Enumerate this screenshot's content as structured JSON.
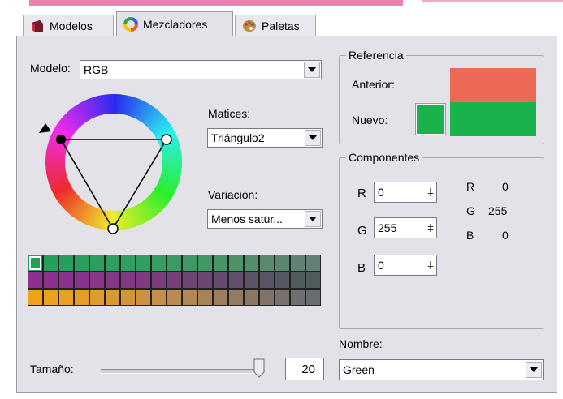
{
  "tabs": [
    {
      "label": "Modelos",
      "icon": "cube-icon",
      "active": false
    },
    {
      "label": "Mezcladores",
      "icon": "color-ring-icon",
      "active": true
    },
    {
      "label": "Paletas",
      "icon": "palette-icon",
      "active": false
    }
  ],
  "model": {
    "label": "Modelo:",
    "value": "RGB"
  },
  "hues": {
    "label": "Matices:",
    "value": "Triángulo2"
  },
  "variation": {
    "label": "Variación:",
    "value": "Menos satur..."
  },
  "reference": {
    "title": "Referencia",
    "previous_label": "Anterior:",
    "new_label": "Nuevo:",
    "previous_color": "#ec6a55",
    "new_color": "#19b24c"
  },
  "components": {
    "title": "Componentes",
    "fields": [
      {
        "label": "R",
        "value": "0"
      },
      {
        "label": "G",
        "value": "255"
      },
      {
        "label": "B",
        "value": "0"
      }
    ],
    "readout": [
      {
        "label": "R",
        "value": "0"
      },
      {
        "label": "G",
        "value": "255"
      },
      {
        "label": "B",
        "value": "0"
      }
    ]
  },
  "name": {
    "label": "Nombre:",
    "value": "Green"
  },
  "size": {
    "label": "Tamaño:",
    "value": "20"
  },
  "swatch_rows": [
    {
      "colors": [
        "#21a05a",
        "#23a05b",
        "#25a05c",
        "#27a05e",
        "#2aa05f",
        "#2d9f60",
        "#309f61",
        "#339e62",
        "#369d63",
        "#3a9c64",
        "#3e9a65",
        "#429866",
        "#479667",
        "#4c9468",
        "#518f6a",
        "#578b6c",
        "#5c876f",
        "#618372",
        "#647f74"
      ]
    },
    {
      "colors": [
        "#8e2f92",
        "#8d3090",
        "#8c318e",
        "#8a338c",
        "#88358a",
        "#853787",
        "#823984",
        "#7e3b81",
        "#7a3e7d",
        "#76417a",
        "#714476",
        "#6c4772",
        "#674b6f",
        "#624f6b",
        "#5d5268",
        "#595565",
        "#555862",
        "#525b5f",
        "#4f5c5d"
      ]
    },
    {
      "colors": [
        "#f0a11c",
        "#eda020",
        "#e99e25",
        "#e59c2a",
        "#e09a30",
        "#da9835",
        "#d3953b",
        "#cc9241",
        "#c48f47",
        "#bb8b4d",
        "#b28753",
        "#a88358",
        "#9e7f5d",
        "#947b62",
        "#8a7766",
        "#80736a",
        "#77706d",
        "#6f6e70",
        "#6a6d70"
      ]
    }
  ]
}
